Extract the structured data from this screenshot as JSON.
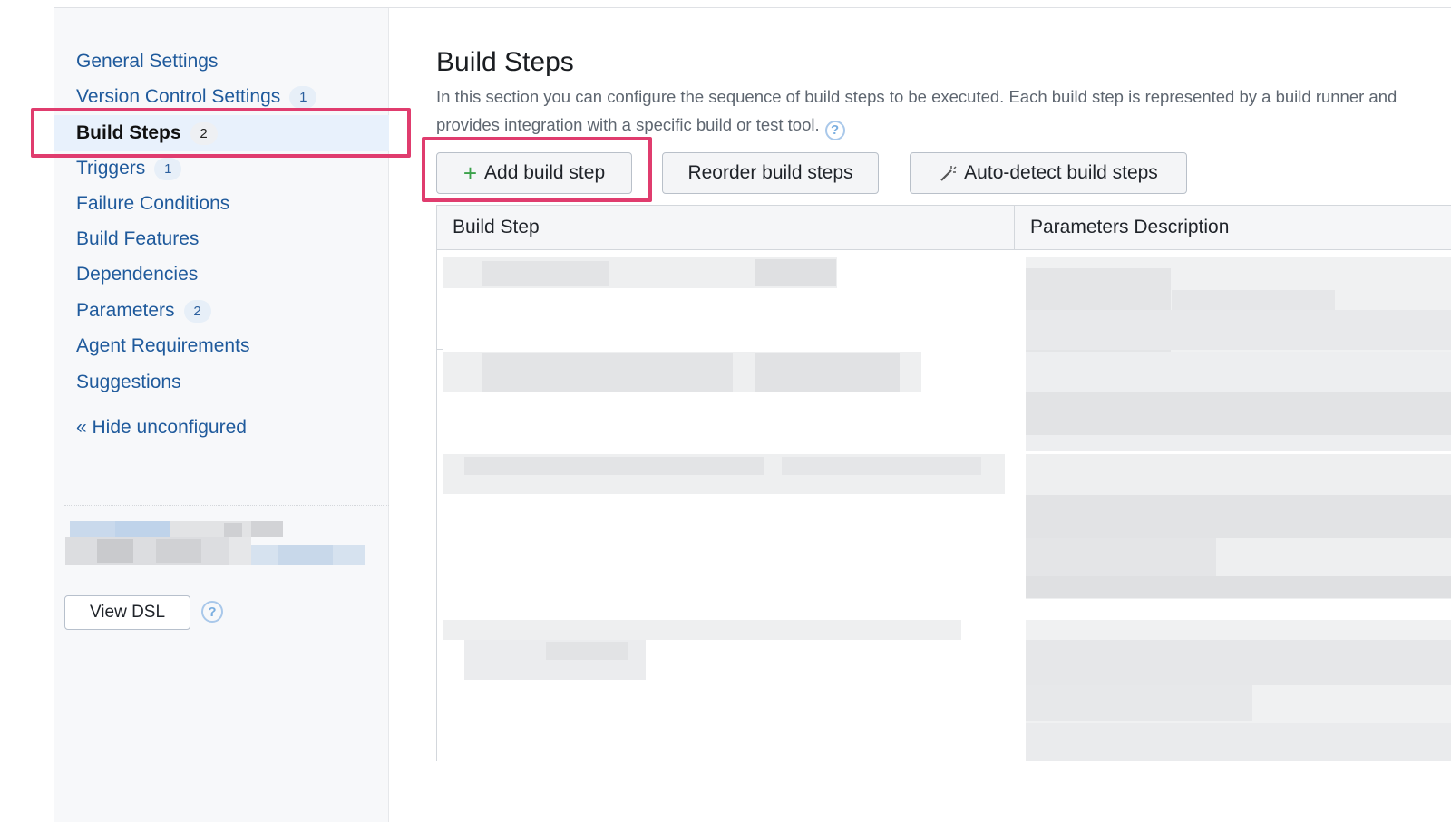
{
  "sidebar": {
    "items": [
      {
        "label": "General Settings",
        "badge": ""
      },
      {
        "label": "Version Control Settings",
        "badge": "1"
      },
      {
        "label": "Build Steps",
        "badge": "2"
      },
      {
        "label": "Triggers",
        "badge": "1"
      },
      {
        "label": "Failure Conditions",
        "badge": ""
      },
      {
        "label": "Build Features",
        "badge": ""
      },
      {
        "label": "Dependencies",
        "badge": ""
      },
      {
        "label": "Parameters",
        "badge": "2"
      },
      {
        "label": "Agent Requirements",
        "badge": ""
      },
      {
        "label": "Suggestions",
        "badge": ""
      }
    ],
    "active_item": "Build Steps",
    "hide_link": "« Hide unconfigured",
    "view_dsl_label": "View DSL",
    "help_glyph": "?"
  },
  "main": {
    "title": "Build Steps",
    "description": "In this section you can configure the sequence of build steps to be executed. Each build step is represented by a build runner and provides integration with a specific build or test tool.",
    "buttons": {
      "add": "Add build step",
      "reorder": "Reorder build steps",
      "autodetect": "Auto-detect build steps"
    },
    "table": {
      "columns": [
        "Build Step",
        "Parameters Description"
      ]
    }
  },
  "colors": {
    "link": "#1f5a9c",
    "active_bg": "#e8f1fc",
    "highlight": "#e03c6e",
    "plus_icon": "#3aa14a"
  }
}
